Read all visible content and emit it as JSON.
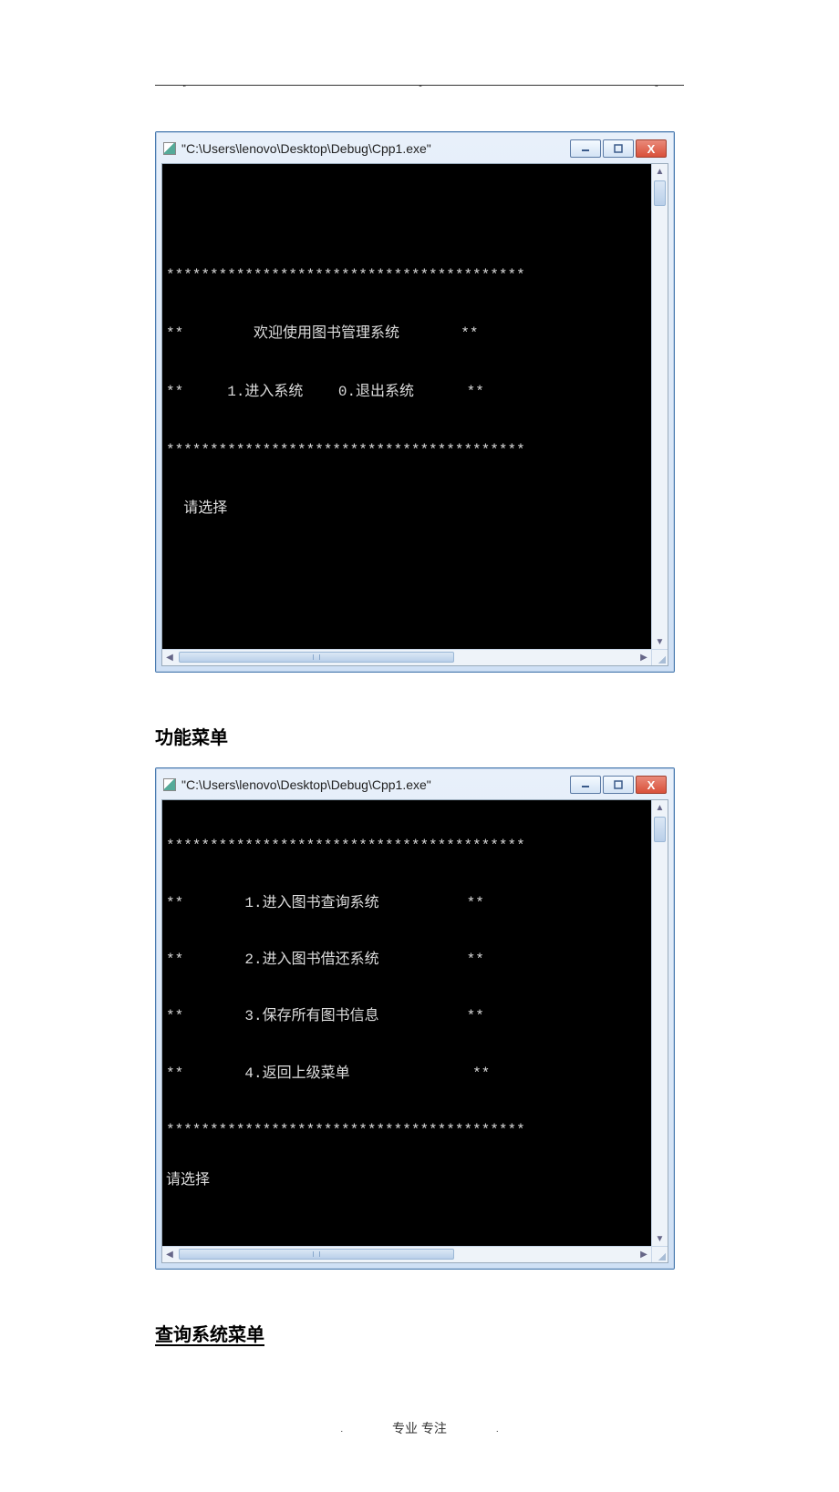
{
  "header_dots": {
    "d1": ". .",
    "d2": ". .",
    "d3": ". ."
  },
  "window1": {
    "title": "\"C:\\Users\\lenovo\\Desktop\\Debug\\Cpp1.exe\"",
    "buttons": {
      "minimize": "—",
      "maximize": "☐",
      "close": "X"
    },
    "console": {
      "border": "*****************************************",
      "welcome_left": "**",
      "welcome_text": "欢迎使用图书管理系统",
      "welcome_right": "**",
      "options_left": "**",
      "option1": "1.进入系统",
      "option0": "0.退出系统",
      "options_right": "**",
      "prompt": "请选择"
    }
  },
  "heading1": "功能菜单",
  "window2": {
    "title": "\"C:\\Users\\lenovo\\Desktop\\Debug\\Cpp1.exe\"",
    "buttons": {
      "minimize": "—",
      "maximize": "☐",
      "close": "X"
    },
    "console": {
      "border": "*****************************************",
      "items": [
        {
          "left": "**",
          "text": "1.进入图书查询系统",
          "right": "**"
        },
        {
          "left": "**",
          "text": "2.进入图书借还系统",
          "right": "**"
        },
        {
          "left": "**",
          "text": "3.保存所有图书信息",
          "right": "**"
        },
        {
          "left": "**",
          "text": "4.返回上级菜单",
          "right": "**"
        }
      ],
      "prompt": "请选择"
    }
  },
  "heading2": "查询系统菜单",
  "footer": {
    "dot_left": ".",
    "text": "专业  专注",
    "dot_right": "."
  }
}
